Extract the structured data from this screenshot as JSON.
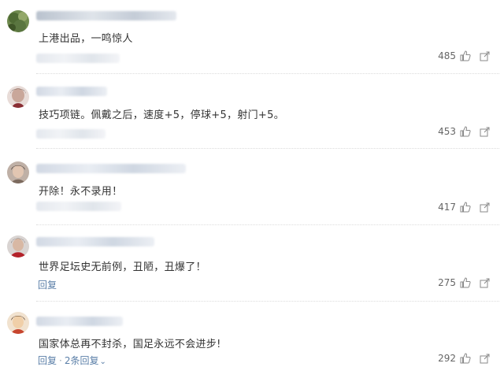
{
  "comments": [
    {
      "text": "上港出品，一鸣惊人",
      "likes": "485",
      "actions": null
    },
    {
      "text": "技巧项链。佩戴之后，速度+5，停球+5，射门+5。",
      "likes": "453",
      "actions": null
    },
    {
      "text": "开除！永不录用！",
      "likes": "417",
      "actions": null
    },
    {
      "text": "世界足坛史无前例，丑陋，丑爆了！",
      "likes": "275",
      "actions": {
        "reply": "回复"
      }
    },
    {
      "text": "国家体总再不封杀，国足永远不会进步!",
      "likes": "292",
      "actions": {
        "reply": "回复",
        "separator": "·",
        "more_replies": "2条回复"
      }
    }
  ],
  "icons": {
    "like": "thumbs-up-icon",
    "share": "share-icon"
  },
  "colors": {
    "link": "#5b7fa8",
    "text": "#333333",
    "muted": "#666666"
  }
}
